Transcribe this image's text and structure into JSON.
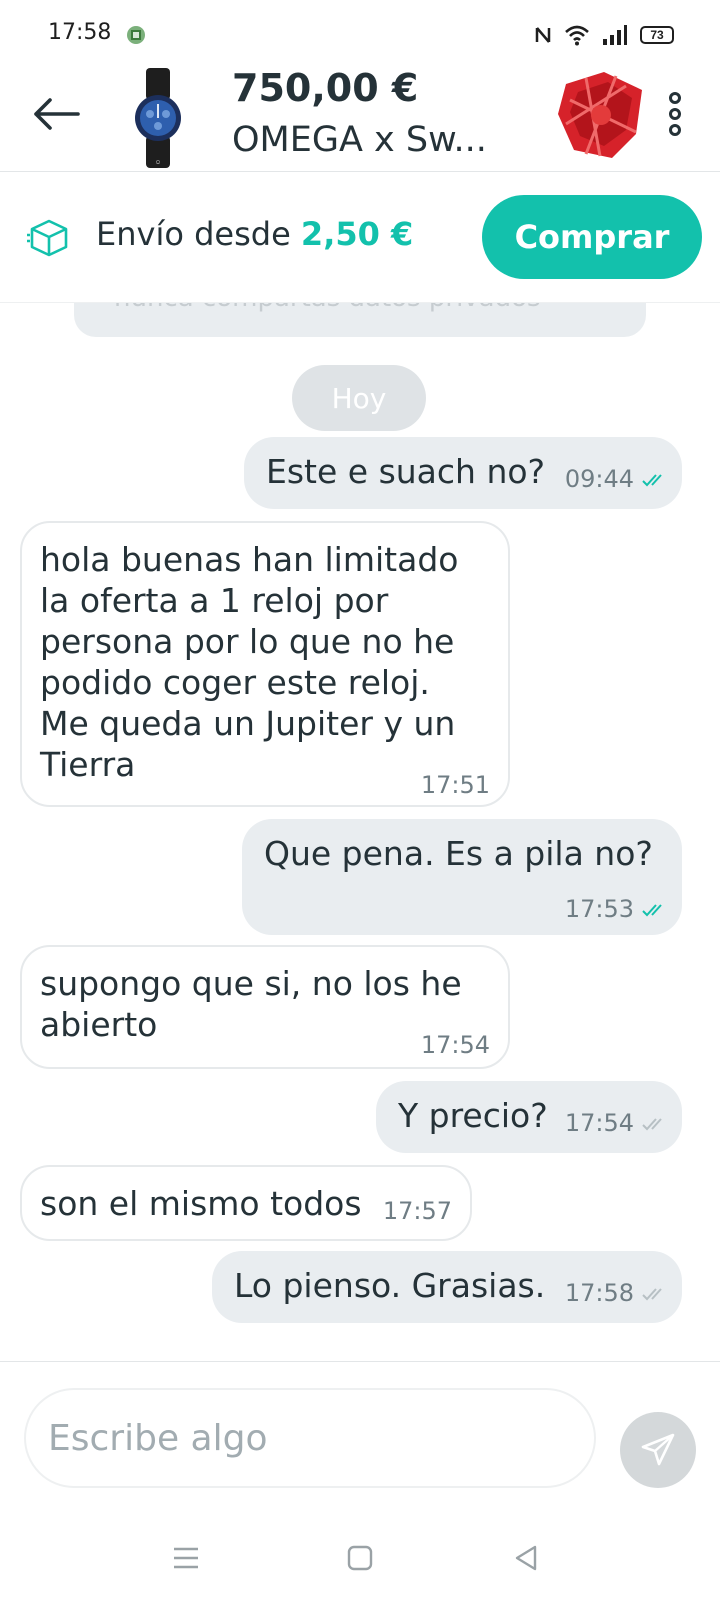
{
  "status_bar": {
    "time": "17:58",
    "battery": "73"
  },
  "header": {
    "price": "750,00 €",
    "title": "OMEGA x Sw..."
  },
  "shipping": {
    "prefix": "Envío desde ",
    "price": "2,50 €",
    "buy_label": "Comprar"
  },
  "chat": {
    "notice_text": "nunca compartas datos privados",
    "day_label": "Hoy",
    "messages": [
      {
        "side": "out",
        "text": "Este e suach no?",
        "time": "09:44",
        "read": true
      },
      {
        "side": "in",
        "text": "hola buenas han limitado\nla oferta a 1 reloj por\npersona por lo que no he\npodido coger este reloj.\nMe queda un Jupiter y un\nTierra",
        "time": "17:51"
      },
      {
        "side": "out",
        "text": "Que pena. Es a pila no?",
        "time": "17:53",
        "read": true
      },
      {
        "side": "in",
        "text": "supongo que si, no los he\nabierto",
        "time": "17:54"
      },
      {
        "side": "out",
        "text": "Y precio?",
        "time": "17:54",
        "read": false
      },
      {
        "side": "in",
        "text": "son el mismo todos",
        "time": "17:57"
      },
      {
        "side": "out",
        "text": "Lo pienso. Grasias.",
        "time": "17:58",
        "read": false
      }
    ]
  },
  "composer": {
    "placeholder": "Escribe algo"
  },
  "colors": {
    "accent": "#13c1ac",
    "bubble_out": "#e9edf0",
    "text": "#253238",
    "read_check": "#13c1ac",
    "unread_check": "#b7c0c4"
  }
}
